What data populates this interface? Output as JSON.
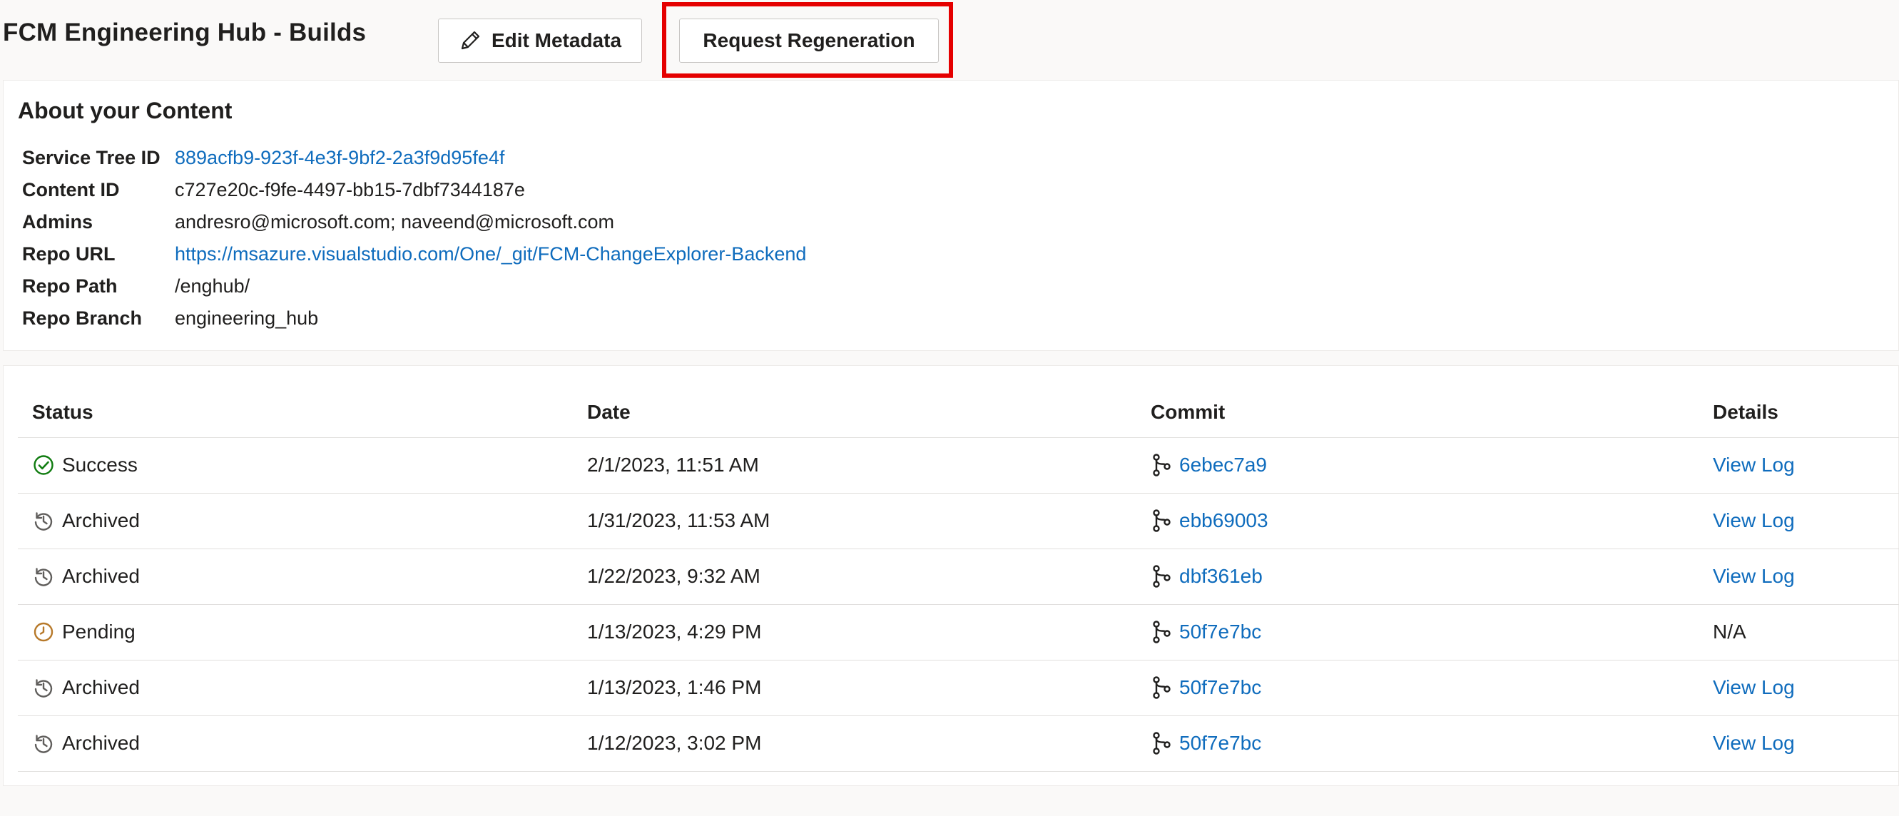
{
  "header": {
    "title": "FCM Engineering Hub - Builds",
    "edit_label": "Edit Metadata",
    "regen_label": "Request Regeneration"
  },
  "about": {
    "title": "About your Content",
    "fields": [
      {
        "label": "Service Tree ID",
        "value": "889acfb9-923f-4e3f-9bf2-2a3f9d95fe4f"
      },
      {
        "label": "Content ID",
        "value": "c727e20c-f9fe-4497-bb15-7dbf7344187e"
      },
      {
        "label": "Admins",
        "value": "andresro@microsoft.com; naveend@microsoft.com"
      },
      {
        "label": "Repo URL",
        "value": "https://msazure.visualstudio.com/One/_git/FCM-ChangeExplorer-Backend"
      },
      {
        "label": "Repo Path",
        "value": "/enghub/"
      },
      {
        "label": "Repo Branch",
        "value": "engineering_hub"
      }
    ]
  },
  "builds": {
    "columns": [
      "Status",
      "Date",
      "Commit",
      "Details"
    ],
    "rows": [
      {
        "status": "Success",
        "status_icon": "check-circle-icon",
        "date": "2/1/2023, 11:51 AM",
        "commit": "6ebec7a9",
        "details": "View Log"
      },
      {
        "status": "Archived",
        "status_icon": "history-icon",
        "date": "1/31/2023, 11:53 AM",
        "commit": "ebb69003",
        "details": "View Log"
      },
      {
        "status": "Archived",
        "status_icon": "history-icon",
        "date": "1/22/2023, 9:32 AM",
        "commit": "dbf361eb",
        "details": "View Log"
      },
      {
        "status": "Pending",
        "status_icon": "clock-icon",
        "date": "1/13/2023, 4:29 PM",
        "commit": "50f7e7bc",
        "details": "N/A"
      },
      {
        "status": "Archived",
        "status_icon": "history-icon",
        "date": "1/13/2023, 1:46 PM",
        "commit": "50f7e7bc",
        "details": "View Log"
      },
      {
        "status": "Archived",
        "status_icon": "history-icon",
        "date": "1/12/2023, 3:02 PM",
        "commit": "50f7e7bc",
        "details": "View Log"
      }
    ]
  },
  "colors": {
    "link": "#0f6cbd",
    "success": "#107c10",
    "pending": "#b7792a",
    "archived": "#605e5c",
    "highlight": "#e50000"
  }
}
